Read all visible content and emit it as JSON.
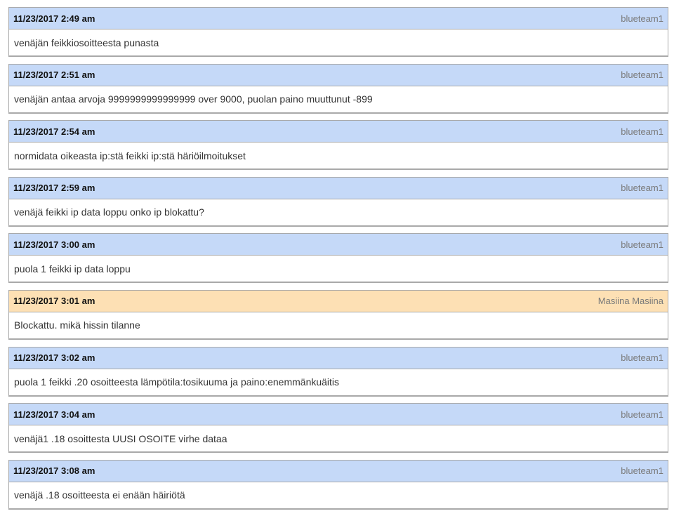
{
  "messages": [
    {
      "time": "11/23/2017 2:49 am",
      "author": "blueteam1",
      "text": "venäjän feikkiosoitteesta punasta",
      "kind": "team"
    },
    {
      "time": "11/23/2017 2:51 am",
      "author": "blueteam1",
      "text": "venäjän antaa arvoja 9999999999999999 over 9000, puolan paino muuttunut -899",
      "kind": "team"
    },
    {
      "time": "11/23/2017 2:54 am",
      "author": "blueteam1",
      "text": "normidata oikeasta ip:stä feikki ip:stä häriöilmoitukset",
      "kind": "team"
    },
    {
      "time": "11/23/2017 2:59 am",
      "author": "blueteam1",
      "text": "venäjä feikki ip data loppu onko ip blokattu?",
      "kind": "team"
    },
    {
      "time": "11/23/2017 3:00 am",
      "author": "blueteam1",
      "text": "puola 1 feikki ip data loppu",
      "kind": "team"
    },
    {
      "time": "11/23/2017 3:01 am",
      "author": "Masiina Masiina",
      "text": "Blockattu. mikä hissin tilanne",
      "kind": "admin"
    },
    {
      "time": "11/23/2017 3:02 am",
      "author": "blueteam1",
      "text": "puola 1 feikki .20 osoitteesta lämpötila:tosikuuma ja paino:enemmänkuäitis",
      "kind": "team"
    },
    {
      "time": "11/23/2017 3:04 am",
      "author": "blueteam1",
      "text": "venäjä1 .18 osoittesta UUSI OSOITE virhe dataa",
      "kind": "team"
    },
    {
      "time": "11/23/2017 3:08 am",
      "author": "blueteam1",
      "text": "venäjä .18 osoitteesta ei enään häiriötä",
      "kind": "team"
    }
  ],
  "colors": {
    "team_header": "#c5d9f8",
    "admin_header": "#fde0b4",
    "border": "#a9a9a9"
  }
}
